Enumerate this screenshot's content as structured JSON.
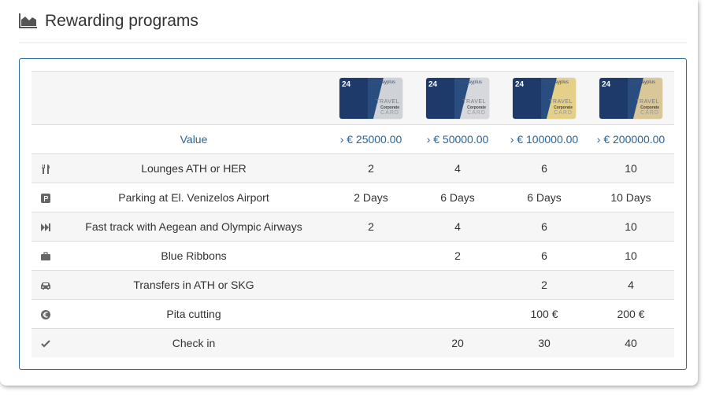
{
  "header": {
    "title": "Rewarding programs",
    "icon": "area-chart-icon"
  },
  "cards": [
    {
      "name": "silver-card",
      "number": "24",
      "logo": "flyawayplus",
      "travel": "TRAVEL",
      "corporate": "Corporate",
      "card": "CARD",
      "tint": "#cfd3d8"
    },
    {
      "name": "platinum-card",
      "number": "24",
      "logo": "flyawayplus",
      "travel": "TRAVEL",
      "corporate": "Corporate",
      "card": "CARD",
      "tint": "#d6d8dc"
    },
    {
      "name": "gold-card",
      "number": "24",
      "logo": "flyawayplus",
      "travel": "TRAVEL",
      "corporate": "Corporate",
      "card": "CARD",
      "tint": "#e5d08a"
    },
    {
      "name": "premium-card",
      "number": "24",
      "logo": "flyawayplus",
      "travel": "TRAVEL",
      "corporate": "Corporate",
      "card": "CARD",
      "tint": "#d9c79a"
    }
  ],
  "value_row": {
    "label": "Value",
    "values": [
      "› € 25000.00",
      "› € 50000.00",
      "› € 100000.00",
      "› € 200000.00"
    ]
  },
  "rows": [
    {
      "icon": "cutlery-icon",
      "label": "Lounges ATH or HER",
      "values": [
        "2",
        "4",
        "6",
        "10"
      ]
    },
    {
      "icon": "parking-icon",
      "label": "Parking at El. Venizelos Airport",
      "values": [
        "2 Days",
        "6 Days",
        "6 Days",
        "10 Days"
      ]
    },
    {
      "icon": "fast-forward-icon",
      "label": "Fast track with Aegean and Olympic Airways",
      "values": [
        "2",
        "4",
        "6",
        "10"
      ]
    },
    {
      "icon": "briefcase-icon",
      "label": "Blue Ribbons",
      "values": [
        "",
        "2",
        "6",
        "10"
      ]
    },
    {
      "icon": "car-icon",
      "label": "Transfers in ATH or SKG",
      "values": [
        "",
        "",
        "2",
        "4"
      ]
    },
    {
      "icon": "euro-icon",
      "label": "Pita cutting",
      "values": [
        "",
        "",
        "100 €",
        "200 €"
      ]
    },
    {
      "icon": "check-icon",
      "label": "Check in",
      "values": [
        "",
        "20",
        "30",
        "40"
      ]
    }
  ],
  "colors": {
    "accent": "#2a6496",
    "border": "#2e6f96",
    "icon": "#666666"
  }
}
